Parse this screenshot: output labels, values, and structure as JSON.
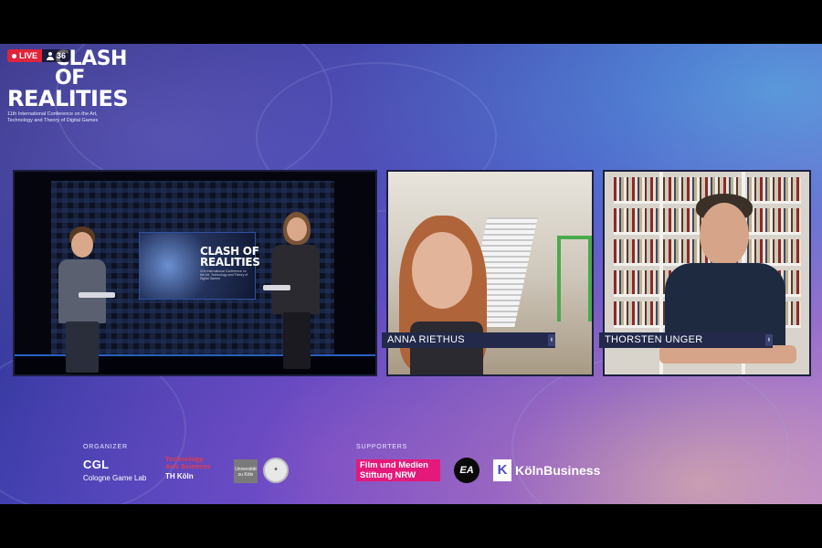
{
  "stream": {
    "live_label": "LIVE",
    "viewer_count": "36"
  },
  "logo": {
    "line1": "CLASH OF",
    "line2": "REALITIES",
    "subtitle": "11th International Conference on the Art, Technology and Theory of Digital Games"
  },
  "studio_screen": {
    "line1": "CLASH OF",
    "line2": "REALITIES",
    "subtitle": "11th International Conference on the Art, Technology and Theory of Digital Games"
  },
  "participants": [
    {
      "name": "ANNA RIETHUS"
    },
    {
      "name": "THORSTEN UNGER"
    }
  ],
  "footer": {
    "organizer_label": "ORGANIZER",
    "supporters_label": "SUPPORTERS",
    "cgl_short": "CGL",
    "cgl_full": "Cologne Game Lab",
    "th_line1": "Technology",
    "th_line2": "Arts Sciences",
    "th_line3": "TH Köln",
    "uni_koeln": "Universität zu Köln",
    "film": "Film und Medien Stiftung NRW",
    "ea": "EA",
    "koeln_business": "KölnBusiness"
  },
  "colors": {
    "live_red": "#e0243a",
    "nameplate": "#22294a",
    "film_pink": "#e5197a"
  }
}
